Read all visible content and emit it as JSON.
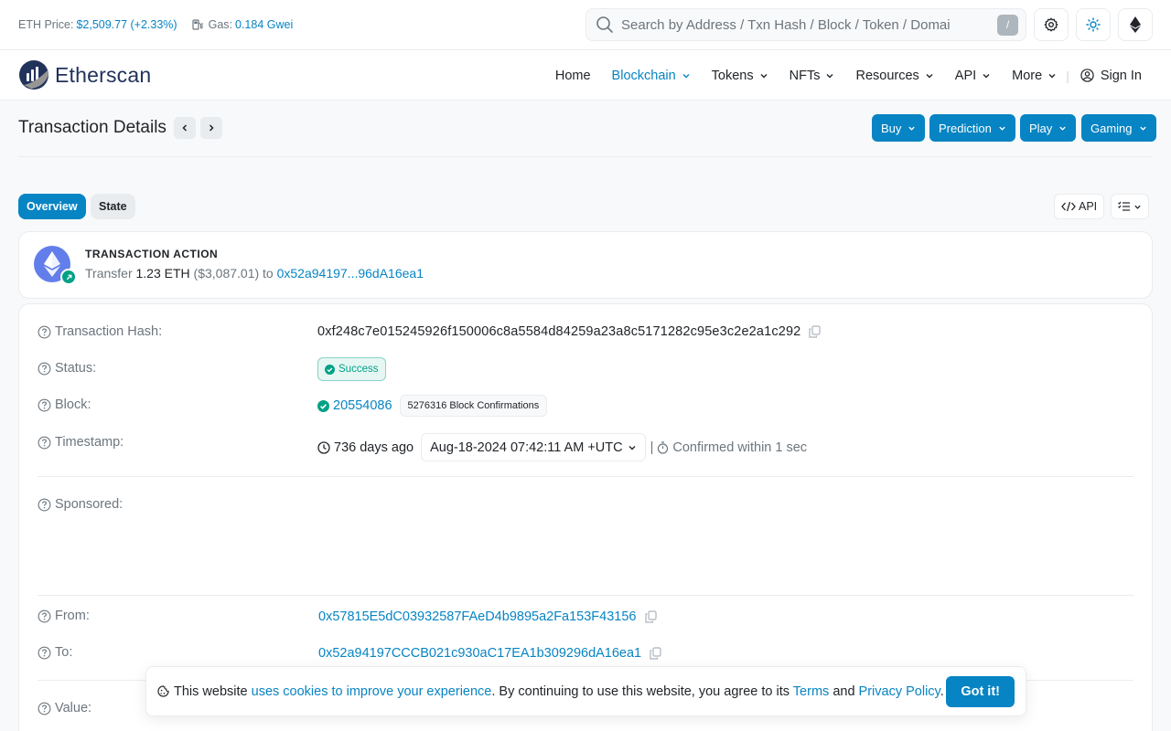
{
  "topbar": {
    "eth_price_label": "ETH Price:",
    "eth_price_value": "$2,509.77 (+2.33%)",
    "gas_label": "Gas:",
    "gas_value": "0.184 Gwei",
    "search_placeholder": "Search by Address / Txn Hash / Block / Token / Domai",
    "search_shortcut": "/",
    "icons": [
      "gear-icon",
      "sun-icon",
      "ethereum-icon"
    ]
  },
  "nav": {
    "brand": "Etherscan",
    "items": [
      {
        "label": "Home"
      },
      {
        "label": "Blockchain",
        "active": true
      },
      {
        "label": "Tokens"
      },
      {
        "label": "NFTs"
      },
      {
        "label": "Resources"
      },
      {
        "label": "API"
      },
      {
        "label": "More"
      }
    ],
    "separator": "|",
    "signin": "Sign In"
  },
  "header": {
    "title": "Transaction Details",
    "buttons": [
      "Buy",
      "Prediction",
      "Play",
      "Gaming"
    ]
  },
  "tabs": {
    "overview": "Overview",
    "state": "State",
    "api_label": "API"
  },
  "action": {
    "title": "TRANSACTION ACTION",
    "verb": "Transfer",
    "amount": "1.23 ETH",
    "usd": "($3,087.01)",
    "to_word": "to",
    "to_address": "0x52a94197...96dA16ea1"
  },
  "details": {
    "hash_label": "Transaction Hash:",
    "hash_value": "0xf248c7e015245926f150006c8a5584d84259a23a8c5171282c95e3c2e2a1c292",
    "status_label": "Status:",
    "status_value": "Success",
    "block_label": "Block:",
    "block_value": "20554086",
    "block_confirmations": "5276316 Block Confirmations",
    "timestamp_label": "Timestamp:",
    "timestamp_ago": "736 days ago",
    "timestamp_value": "Aug-18-2024 07:42:11 AM +UTC",
    "timestamp_sep": "|",
    "timestamp_confirmed": "Confirmed within 1 sec",
    "sponsored_label": "Sponsored:",
    "from_label": "From:",
    "from_value": "0x57815E5dC03932587FAeD4b9895a2Fa153F43156",
    "to_label": "To:",
    "to_value": "0x52a94197CCCB021c930aC17EA1b309296dA16ea1",
    "value_label": "Value:"
  },
  "cookie": {
    "prefix": "This website",
    "link1": "uses cookies to improve your experience",
    "middle": ". By continuing to use this website, you agree to its",
    "terms": "Terms",
    "and": "and",
    "privacy": "Privacy Policy",
    "suffix": ".",
    "button": "Got it!"
  },
  "colors": {
    "accent": "#0784c3",
    "success": "#00a186",
    "ethereum": "#627eea",
    "brand_dark": "#21325b"
  }
}
